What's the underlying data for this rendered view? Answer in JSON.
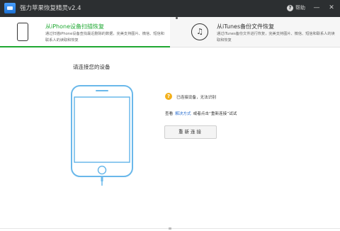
{
  "window": {
    "title": "强力苹果恢复精灵v2.4",
    "help_label": "帮助",
    "minimize_glyph": "—",
    "close_glyph": "✕"
  },
  "tabs": [
    {
      "title": "从iPhone设备扫描恢复",
      "desc": "通过扫描iPhone设备查找最近删除的数据，完美支持图片、微信、短信和联系人的读取和恢复",
      "icon": "phone-icon",
      "active": true
    },
    {
      "title": "从iTunes备份文件恢复",
      "desc": "通过iTunes备份文件进行恢复，完美支持图片、微信、短信和联系人的读取和恢复",
      "icon": "music-note-icon",
      "active": false
    }
  ],
  "main": {
    "prompt": "请连接您的设备",
    "status_text": "已连接设备，无法识别",
    "hint_prefix": "查看",
    "hint_link": "解决方式",
    "hint_suffix": "或者点击“重新连接”试试",
    "reconnect_label": "重新连接"
  },
  "colors": {
    "accent": "#1fa832",
    "titlebar": "#2c2f31",
    "phone_outline": "#6ab8ea",
    "warning": "#f3b01b",
    "link": "#2a6fd0"
  }
}
